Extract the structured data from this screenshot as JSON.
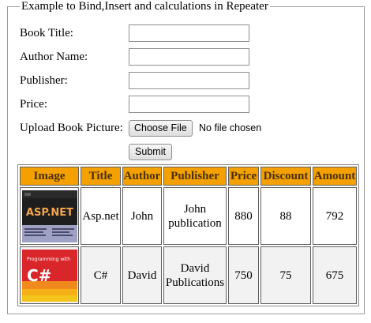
{
  "form": {
    "legend": "Example to Bind,Insert and calculations in Repeater",
    "book_title_label": "Book Title:",
    "book_title_value": "",
    "author_name_label": "Author Name:",
    "author_name_value": "",
    "publisher_label": "Publisher:",
    "publisher_value": "",
    "price_label": "Price:",
    "price_value": "",
    "upload_label": "Upload Book Picture:",
    "choose_file_label": "Choose File",
    "file_status": "No file chosen",
    "submit_label": "Submit"
  },
  "table": {
    "columns": [
      "Image",
      "Title",
      "Author",
      "Publisher",
      "Price",
      "Discount",
      "Amount"
    ],
    "rows": [
      {
        "image_icon": "aspnet-book-cover",
        "title": "Asp.net",
        "author": "John",
        "publisher": "John publication",
        "price": "880",
        "discount": "88",
        "amount": "792"
      },
      {
        "image_icon": "csharp-book-cover",
        "title": "C#",
        "author": "David",
        "publisher": "David Publications",
        "price": "750",
        "discount": "75",
        "amount": "675"
      }
    ]
  },
  "colors": {
    "header_background": "#f4a100",
    "header_text": "#4a3000",
    "alt_row_background": "#f2f2f2"
  },
  "covers": {
    "aspnet": {
      "logo_text": "ASP.NET"
    },
    "csharp": {
      "top_text": "Programming with",
      "logo_text": "C#"
    }
  }
}
